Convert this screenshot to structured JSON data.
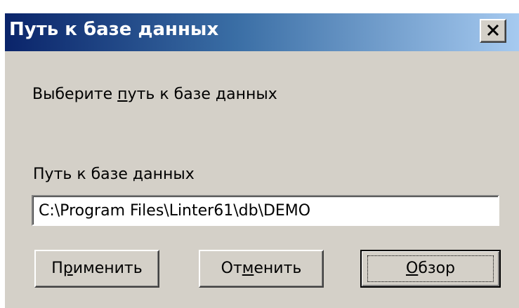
{
  "window": {
    "title": "Путь к базе данных",
    "colors": {
      "title_gradient_start": "#0a246a",
      "title_gradient_end": "#a6caf0",
      "face": "#d4d0c8"
    }
  },
  "titlebar": {
    "close_icon": "close-x-icon"
  },
  "instruction": {
    "before": "Выберите ",
    "accel": "п",
    "after": "уть к базе данных"
  },
  "field": {
    "label": "Путь к базе данных",
    "value": "C:\\Program Files\\Linter61\\db\\DEMO"
  },
  "buttons": {
    "apply": {
      "before": "П",
      "accel": "р",
      "after": "именить"
    },
    "cancel": {
      "before": "От",
      "accel": "м",
      "after": "енить"
    },
    "browse": {
      "before": "",
      "accel": "О",
      "after": "бзор"
    }
  }
}
